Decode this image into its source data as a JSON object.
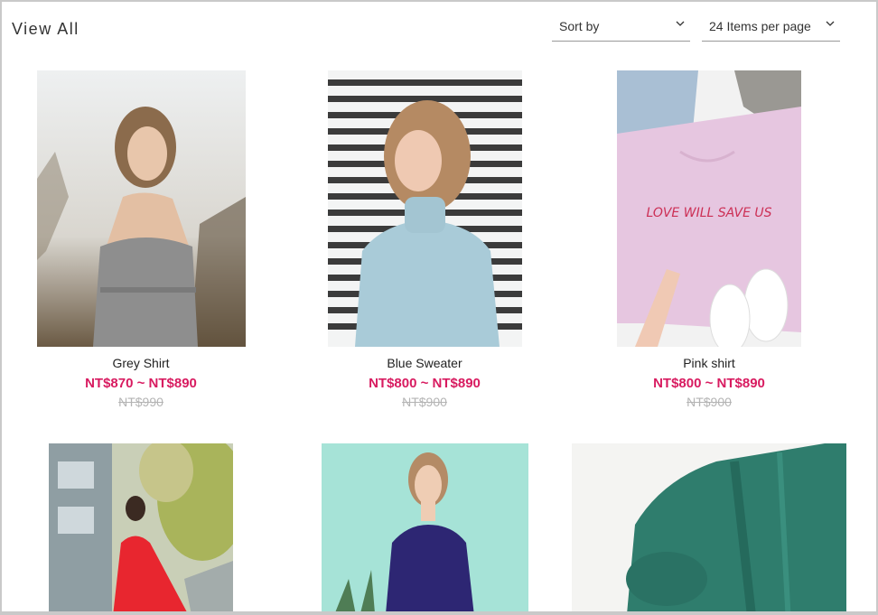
{
  "header": {
    "title": "View All",
    "sort_label": "Sort by",
    "per_page_label": "24 Items per page"
  },
  "products": [
    {
      "name": "Grey Shirt",
      "price": "NT$870 ~ NT$890",
      "old_price": "NT$990"
    },
    {
      "name": "Blue Sweater",
      "price": "NT$800 ~ NT$890",
      "old_price": "NT$900"
    },
    {
      "name": "Pink shirt",
      "price": "NT$800 ~ NT$890",
      "old_price": "NT$900"
    },
    {
      "name": "",
      "price": "",
      "old_price": ""
    },
    {
      "name": "",
      "price": "",
      "old_price": ""
    },
    {
      "name": "",
      "price": "",
      "old_price": ""
    }
  ],
  "graphic": {
    "shirt_print": "LOVE WILL SAVE US"
  },
  "colors": {
    "accent": "#d81b60",
    "strike": "#b4b4b4"
  }
}
